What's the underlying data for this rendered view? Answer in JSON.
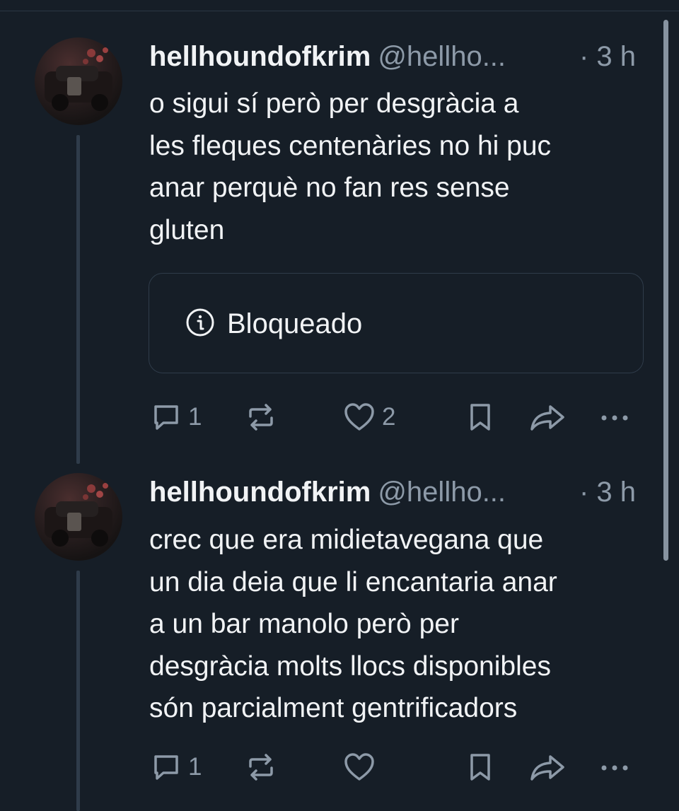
{
  "posts": [
    {
      "author_name": "hellhoundofkrim",
      "author_handle": "@hellho...",
      "time": "· 3 h",
      "text_lines": [
        "o sigui sí però per desgràcia a",
        "les fleques centenàries no hi puc",
        "anar perquè no fan res sense",
        "gluten"
      ],
      "blocked_label": "Bloqueado",
      "reply_count": "1",
      "repost_count": "",
      "like_count": "2"
    },
    {
      "author_name": "hellhoundofkrim",
      "author_handle": "@hellho...",
      "time": "· 3 h",
      "text_lines": [
        "crec que era midietavegana que",
        "un dia deia que li encantaria anar",
        "a un bar manolo però per",
        "desgràcia molts llocs disponibles",
        "són parcialment gentrificadors"
      ],
      "reply_count": "1",
      "repost_count": "",
      "like_count": ""
    }
  ],
  "icons": {
    "reply": "reply-icon",
    "repost": "repost-icon",
    "like": "heart-icon",
    "bookmark": "bookmark-icon",
    "share": "share-icon",
    "more": "more-icon",
    "info": "info-icon"
  },
  "colors": {
    "background": "#161e27",
    "text": "#f1f3f5",
    "muted": "#8d9aa8",
    "border": "#2f3c4a"
  }
}
